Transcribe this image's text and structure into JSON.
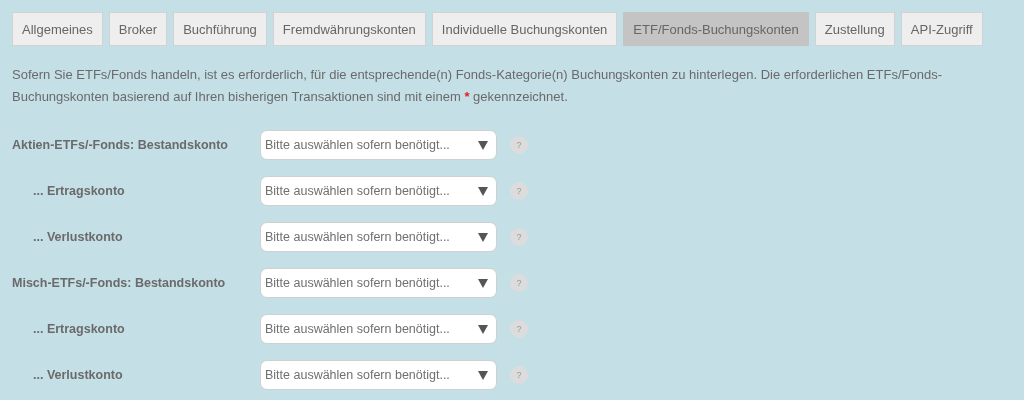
{
  "tabs": [
    {
      "label": "Allgemeines",
      "selected": false
    },
    {
      "label": "Broker",
      "selected": false
    },
    {
      "label": "Buchführung",
      "selected": false
    },
    {
      "label": "Fremdwährungskonten",
      "selected": false
    },
    {
      "label": "Individuelle Buchungskonten",
      "selected": false
    },
    {
      "label": "ETF/Fonds-Buchungskonten",
      "selected": true
    },
    {
      "label": "Zustellung",
      "selected": false
    },
    {
      "label": "API-Zugriff",
      "selected": false
    }
  ],
  "description": {
    "before": "Sofern Sie ETFs/Fonds handeln, ist es erforderlich, für die entsprechende(n) Fonds-Kategorie(n) Buchungskonten zu hinterlegen. Die erforderlichen ETFs/Fonds-Buchungskonten basierend auf Ihren bisherigen Transaktionen sind mit einem",
    "marker": "*",
    "after": "gekennzeichnet."
  },
  "fields": [
    {
      "label": "Aktien-ETFs/-Fonds: Bestandskonto",
      "kind": "main",
      "placeholder": "Bitte auswählen sofern benötigt...",
      "help": "?"
    },
    {
      "label": "... Ertragskonto",
      "kind": "sub",
      "placeholder": "Bitte auswählen sofern benötigt...",
      "help": "?"
    },
    {
      "label": "... Verlustkonto",
      "kind": "sub",
      "placeholder": "Bitte auswählen sofern benötigt...",
      "help": "?"
    },
    {
      "label": "Misch-ETFs/-Fonds: Bestandskonto",
      "kind": "main",
      "placeholder": "Bitte auswählen sofern benötigt...",
      "help": "?"
    },
    {
      "label": "... Ertragskonto",
      "kind": "sub",
      "placeholder": "Bitte auswählen sofern benötigt...",
      "help": "?"
    },
    {
      "label": "... Verlustkonto",
      "kind": "sub",
      "placeholder": "Bitte auswählen sofern benötigt...",
      "help": "?"
    }
  ]
}
